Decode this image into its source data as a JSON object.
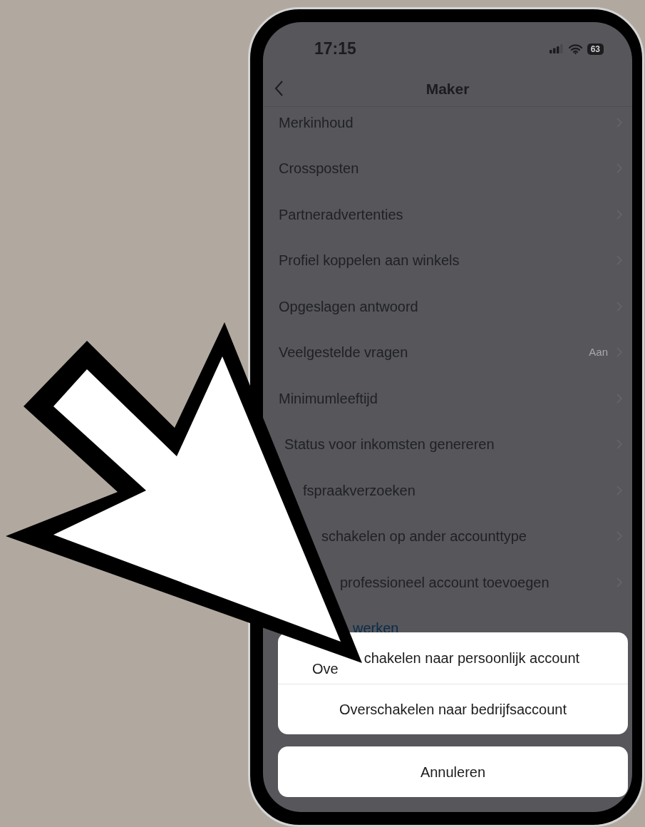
{
  "status_bar": {
    "time": "17:15",
    "battery": "63"
  },
  "nav": {
    "title": "Maker"
  },
  "rows": [
    {
      "kind": "item",
      "label": "Merkinhoud"
    },
    {
      "kind": "item",
      "label": "Crossposten"
    },
    {
      "kind": "item",
      "label": "Partneradvertenties"
    },
    {
      "kind": "item",
      "label": "Profiel koppelen aan winkels"
    },
    {
      "kind": "item",
      "label": "Opgeslagen antwoord"
    },
    {
      "kind": "item",
      "label": "Veelgestelde vragen",
      "value": "Aan"
    },
    {
      "kind": "item",
      "label": "Minimumleeftijd"
    },
    {
      "kind": "item",
      "label": "Status voor inkomsten genereren"
    },
    {
      "kind": "item",
      "label": "fspraakverzoeken"
    },
    {
      "kind": "item",
      "label": "schakelen op ander accounttype"
    },
    {
      "kind": "item",
      "label": "professioneel account toevoegen"
    },
    {
      "kind": "link",
      "label": "werken"
    }
  ],
  "action_sheet": {
    "options": [
      {
        "fragments": [
          "Ove",
          "chakelen naar persoonlijk account"
        ]
      },
      {
        "fragments": [
          "Overschakelen naar bedrijfsaccount"
        ]
      }
    ],
    "cancel": "Annuleren"
  }
}
